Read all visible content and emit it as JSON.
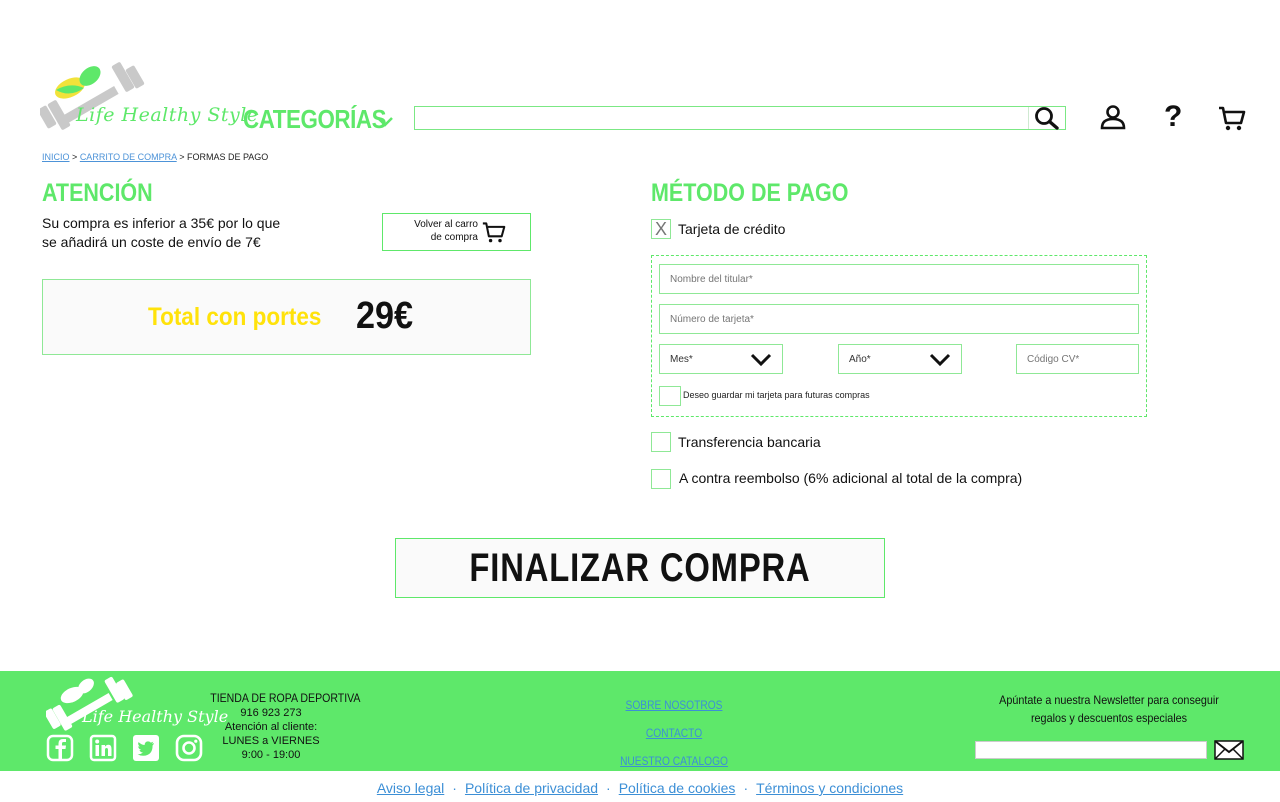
{
  "header": {
    "logo_text": "Life Healthy Style",
    "categories_label": "CATEGORÍAS",
    "search": {
      "value": "",
      "placeholder": ""
    }
  },
  "breadcrumb": {
    "inicio": "INICIO",
    "sep1": ">",
    "carrito": "CARRITO DE COMPRA",
    "sep2": ">",
    "current": "FORMAS DE PAGO"
  },
  "attention": {
    "title": "ATENCIÓN",
    "line1": "Su compra es inferior a 35€ por lo que",
    "line2": "se añadirá un coste de envío de 7€",
    "back_line1": "Volver al carro",
    "back_line2": "de compra",
    "total_label": "Total con portes",
    "total_value": "29€"
  },
  "payment": {
    "title": "MÉTODO DE PAGO",
    "credit_card": {
      "mark": "X",
      "label": "Tarjeta de crédito",
      "checked": true
    },
    "card_fields": {
      "nombre": "Nombre del titular*",
      "numero": "Número de tarjeta*",
      "mes": "Mes*",
      "ano": "Año*",
      "cv": "Código CV*",
      "save_label": "Deseo guardar mi tarjeta para futuras compras"
    },
    "transfer": {
      "label": "Transferencia bancaria",
      "checked": false
    },
    "cod": {
      "label": "A contra reembolso (6% adicional al total de la compra)",
      "checked": false
    }
  },
  "finalize_label": "FINALIZAR COMPRA",
  "footer": {
    "logo_text": "Life Healthy Style",
    "store_name": "TIENDA DE ROPA DEPORTIVA",
    "phone": "916 923 273",
    "attention": "Atención al cliente:",
    "days": "LUNES a VIERNES",
    "hours": "9:00 - 19:00",
    "links": [
      "SOBRE NOSOTROS",
      "CONTACTO",
      "NUESTRO CATALOGO"
    ],
    "newsletter_line1": "Apúntate a nuestra Newsletter para conseguir",
    "newsletter_line2": "regalos y descuentos especiales",
    "newsletter_placeholder": ""
  },
  "legal": {
    "aviso": "Aviso legal",
    "privacidad": "Política de privacidad",
    "cookies": "Política de cookies",
    "terminos": "Términos y condiciones",
    "separator": "·"
  },
  "colors": {
    "brand_green": "#5ee86a",
    "total_yellow": "#ffe20a",
    "link_blue": "#3c8fd6"
  },
  "icons": [
    "dumbbell-logo-icon",
    "chevron-down-icon",
    "search-icon",
    "user-icon",
    "help-icon",
    "cart-icon",
    "facebook-icon",
    "linkedin-icon",
    "twitter-icon",
    "instagram-icon",
    "mail-icon"
  ]
}
